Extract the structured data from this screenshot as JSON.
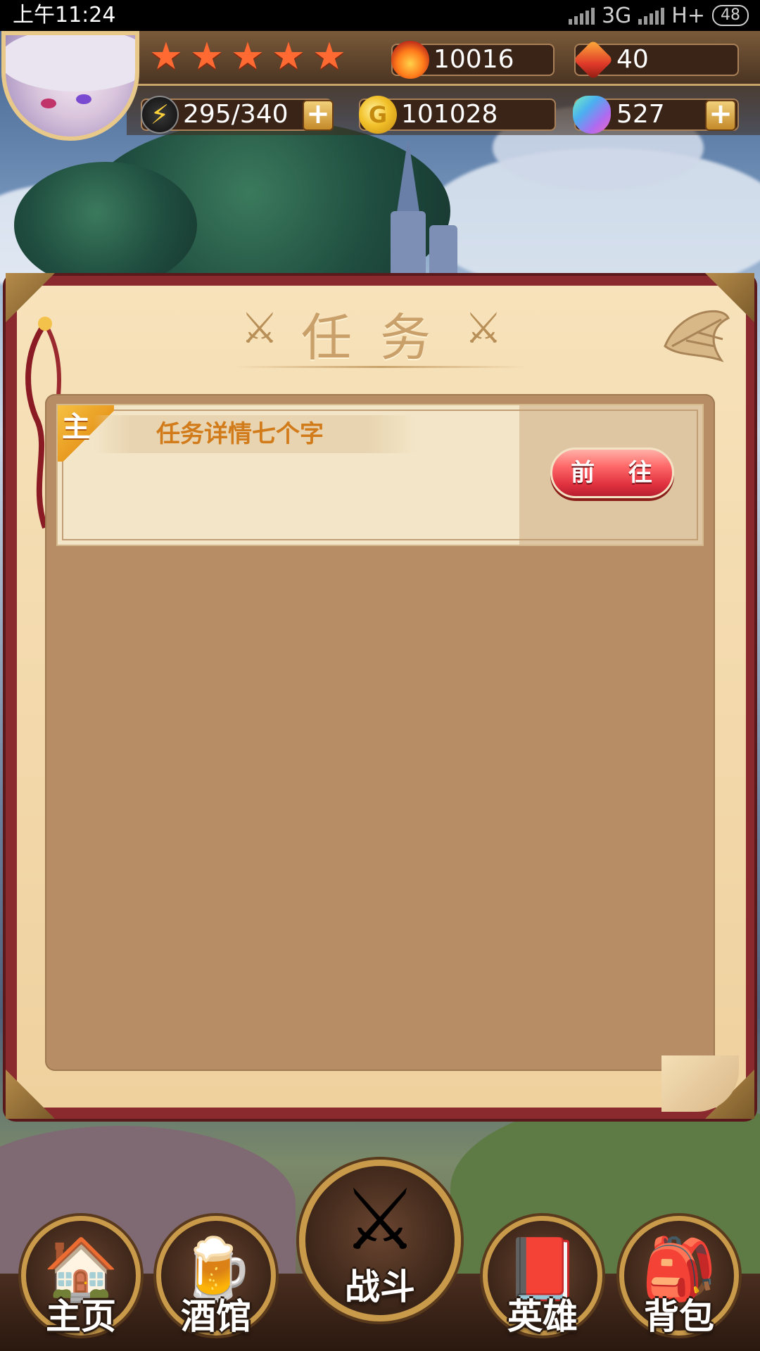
{
  "status_bar": {
    "time": "上午11:24",
    "network_1": "3G",
    "network_2": "H+",
    "battery": "48"
  },
  "hud": {
    "star_rating": 5,
    "power": {
      "icon": "flame-icon",
      "value": "10016"
    },
    "gems_red": {
      "icon": "red-gem-icon",
      "value": "40"
    },
    "energy": {
      "icon": "lightning-icon",
      "value": "295/340"
    },
    "gold": {
      "icon": "gold-coin-icon",
      "value": "101028"
    },
    "crystals": {
      "icon": "crystal-icon",
      "value": "527"
    }
  },
  "panel": {
    "title": "任务",
    "tasks": [
      {
        "tag": "主",
        "name": "任务详情七个字",
        "action_label": "前 往"
      }
    ]
  },
  "nav": {
    "items": [
      {
        "label": "主页",
        "icon": "house-icon"
      },
      {
        "label": "酒馆",
        "icon": "beer-mug-icon"
      },
      {
        "label": "战斗",
        "icon": "crossed-swords-icon"
      },
      {
        "label": "英雄",
        "icon": "hero-book-icon"
      },
      {
        "label": "背包",
        "icon": "backpack-icon"
      }
    ]
  },
  "colors": {
    "panel_bg": "#f3d9ac",
    "panel_frame": "#8a2a2e",
    "inner_bg": "#b68d64",
    "task_name": "#d27b1a",
    "go_button": "#e0313f"
  }
}
